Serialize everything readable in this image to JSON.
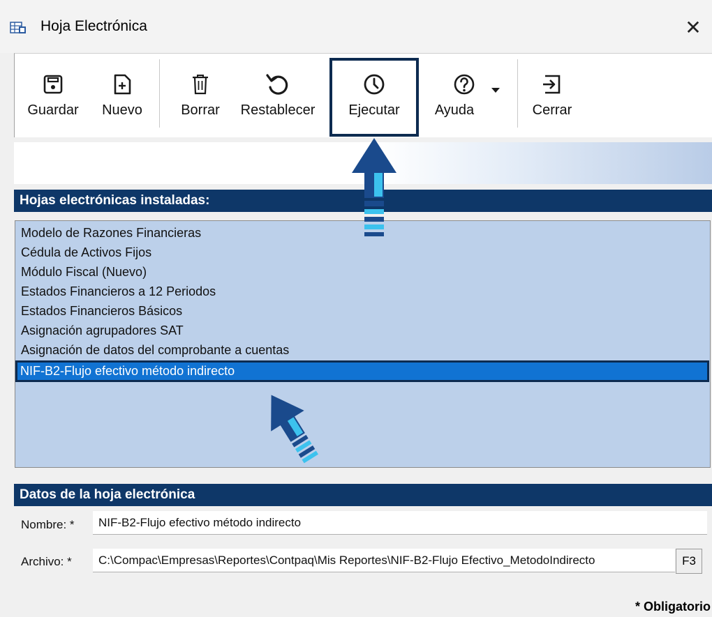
{
  "window": {
    "title": "Hoja Electrónica",
    "close_glyph": "✕"
  },
  "toolbar": {
    "buttons": [
      {
        "label": "Guardar",
        "icon": "save-icon"
      },
      {
        "label": "Nuevo",
        "icon": "new-document-icon"
      },
      {
        "label": "Borrar",
        "icon": "trash-icon"
      },
      {
        "label": "Restablecer",
        "icon": "reset-icon"
      },
      {
        "label": "Ejecutar",
        "icon": "clock-icon"
      },
      {
        "label": "Ayuda",
        "icon": "help-icon"
      },
      {
        "label": "Cerrar",
        "icon": "exit-icon"
      }
    ]
  },
  "installed": {
    "header": "Hojas electrónicas instaladas:",
    "items": [
      "Modelo de Razones Financieras",
      "Cédula de Activos Fijos",
      "Módulo Fiscal (Nuevo)",
      "Estados Financieros a 12 Periodos",
      "Estados Financieros Básicos",
      "Asignación agrupadores SAT",
      "Asignación de datos del comprobante a cuentas",
      "NIF-B2-Flujo efectivo método indirecto"
    ],
    "selected_index": 7
  },
  "details": {
    "header": "Datos de la hoja electrónica",
    "name_label": "Nombre: *",
    "name_value": "NIF-B2-Flujo efectivo método indirecto",
    "file_label": "Archivo: *",
    "file_value": "C:\\Compac\\Empresas\\Reportes\\Contpaq\\Mis Reportes\\NIF-B2-Flujo Efectivo_MetodoIndirecto",
    "file_button": "F3"
  },
  "footer": {
    "required_note": "* Obligatorio"
  },
  "colors": {
    "header_bg": "#0e3768",
    "list_bg": "#bcd0ea",
    "selected_bg": "#1173d3",
    "arrow_dark": "#1a4a8c",
    "arrow_light": "#3cc2ee"
  }
}
